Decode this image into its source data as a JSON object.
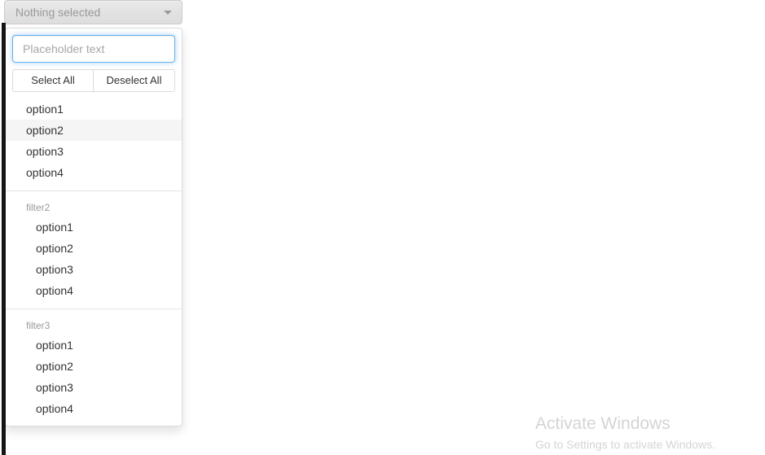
{
  "toggle": {
    "label": "Nothing selected",
    "caret_icon": "chevron-down-icon"
  },
  "search": {
    "value": "",
    "placeholder": "Placeholder text"
  },
  "actions": {
    "select_all_label": "Select All",
    "deselect_all_label": "Deselect All"
  },
  "groups": [
    {
      "label": "",
      "nested": false,
      "options": [
        {
          "label": "option1",
          "active": false
        },
        {
          "label": "option2",
          "active": true
        },
        {
          "label": "option3",
          "active": false
        },
        {
          "label": "option4",
          "active": false
        }
      ]
    },
    {
      "label": "filter2",
      "nested": true,
      "options": [
        {
          "label": "option1",
          "active": false
        },
        {
          "label": "option2",
          "active": false
        },
        {
          "label": "option3",
          "active": false
        },
        {
          "label": "option4",
          "active": false
        }
      ]
    },
    {
      "label": "filter3",
      "nested": true,
      "options": [
        {
          "label": "option1",
          "active": false
        },
        {
          "label": "option2",
          "active": false
        },
        {
          "label": "option3",
          "active": false
        },
        {
          "label": "option4",
          "active": false
        }
      ]
    }
  ],
  "watermark": {
    "title": "Activate Windows",
    "subtitle": "Go to Settings to activate Windows."
  },
  "colors": {
    "focus_border": "#66afe9",
    "hover_row": "#f5f5f5",
    "muted_text": "#999999",
    "watermark_text": "#d4d4d4"
  }
}
